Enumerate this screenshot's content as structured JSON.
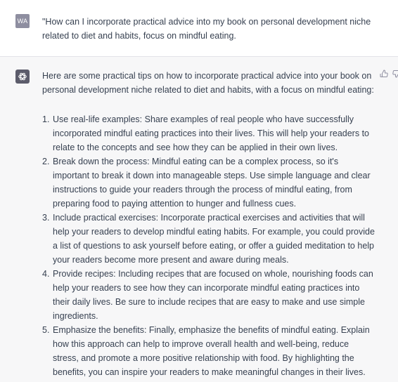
{
  "user": {
    "avatar_initials": "WA",
    "message": "\"How can I incorporate practical advice into my book on personal development niche related to diet and habits, focus on mindful eating."
  },
  "assistant": {
    "avatar_icon": "openai-logo-icon",
    "intro": "Here are some practical tips on how to incorporate practical advice into your book on personal development niche related to diet and habits, with a focus on mindful eating:",
    "tips": [
      {
        "num": "1.",
        "text": "Use real-life examples: Share examples of real people who have successfully incorporated mindful eating practices into their lives. This will help your readers to relate to the concepts and see how they can be applied in their own lives."
      },
      {
        "num": "2.",
        "text": "Break down the process: Mindful eating can be a complex process, so it's important to break it down into manageable steps. Use simple language and clear instructions to guide your readers through the process of mindful eating, from preparing food to paying attention to hunger and fullness cues."
      },
      {
        "num": "3.",
        "text": "Include practical exercises: Incorporate practical exercises and activities that will help your readers to develop mindful eating habits. For example, you could provide a list of questions to ask yourself before eating, or offer a guided meditation to help your readers become more present and aware during meals."
      },
      {
        "num": "4.",
        "text": "Provide recipes: Including recipes that are focused on whole, nourishing foods can help your readers to see how they can incorporate mindful eating practices into their daily lives. Be sure to include recipes that are easy to make and use simple ingredients."
      },
      {
        "num": "5.",
        "text": "Emphasize the benefits: Finally, emphasize the benefits of mindful eating. Explain how this approach can help to improve overall health and well-being, reduce stress, and promote a more positive relationship with food. By highlighting the benefits, you can inspire your readers to make meaningful changes in their lives."
      }
    ],
    "feedback": {
      "thumbs_up_icon": "thumbs-up-icon",
      "thumbs_down_icon": "thumbs-down-icon"
    }
  }
}
